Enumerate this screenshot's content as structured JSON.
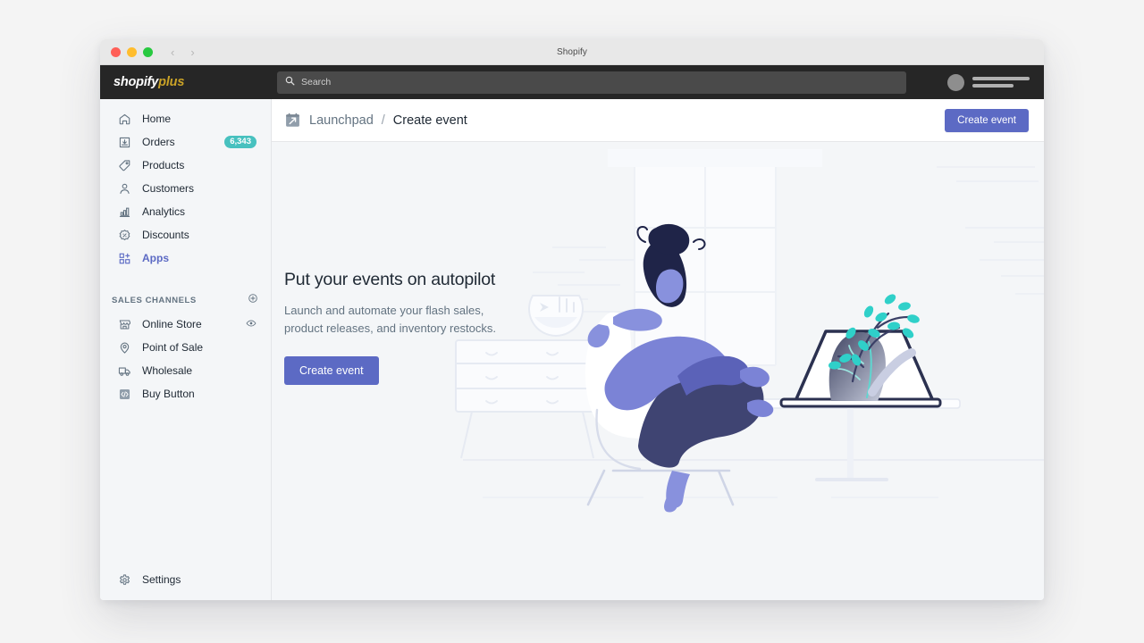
{
  "window": {
    "title": "Shopify",
    "traffic_lights": [
      "close",
      "minimize",
      "maximize"
    ],
    "back_arrow": "‹",
    "forward_arrow": "›"
  },
  "topbar": {
    "brand_primary": "shopify",
    "brand_secondary": "plus",
    "search_placeholder": "Search",
    "search_value": ""
  },
  "sidebar": {
    "items": [
      {
        "label": "Home",
        "icon": "home-icon",
        "badge": "",
        "active": false
      },
      {
        "label": "Orders",
        "icon": "orders-icon",
        "badge": "6,343",
        "active": false
      },
      {
        "label": "Products",
        "icon": "products-icon",
        "badge": "",
        "active": false
      },
      {
        "label": "Customers",
        "icon": "customers-icon",
        "badge": "",
        "active": false
      },
      {
        "label": "Analytics",
        "icon": "analytics-icon",
        "badge": "",
        "active": false
      },
      {
        "label": "Discounts",
        "icon": "discounts-icon",
        "badge": "",
        "active": false
      },
      {
        "label": "Apps",
        "icon": "apps-icon",
        "badge": "",
        "active": true
      }
    ],
    "section_title": "SALES CHANNELS",
    "channels": [
      {
        "label": "Online Store",
        "icon": "store-icon"
      },
      {
        "label": "Point of Sale",
        "icon": "location-pin-icon"
      },
      {
        "label": "Wholesale",
        "icon": "truck-icon"
      },
      {
        "label": "Buy Button",
        "icon": "code-icon"
      }
    ],
    "settings_label": "Settings"
  },
  "page_header": {
    "breadcrumb_root": "Launchpad",
    "breadcrumb_separator": "/",
    "breadcrumb_current": "Create event",
    "primary_button": "Create event"
  },
  "hero": {
    "heading": "Put your events on autopilot",
    "description": "Launch and automate your flash sales, product releases, and inventory restocks.",
    "cta_label": "Create event"
  },
  "colors": {
    "accent_indigo": "#5c6ac4",
    "badge_teal": "#47c1bf",
    "topbar_dark": "#262626",
    "brand_gold": "#c9a227",
    "sidebar_bg": "#f4f6f8",
    "text_primary": "#212b36",
    "text_subdued": "#637381"
  }
}
